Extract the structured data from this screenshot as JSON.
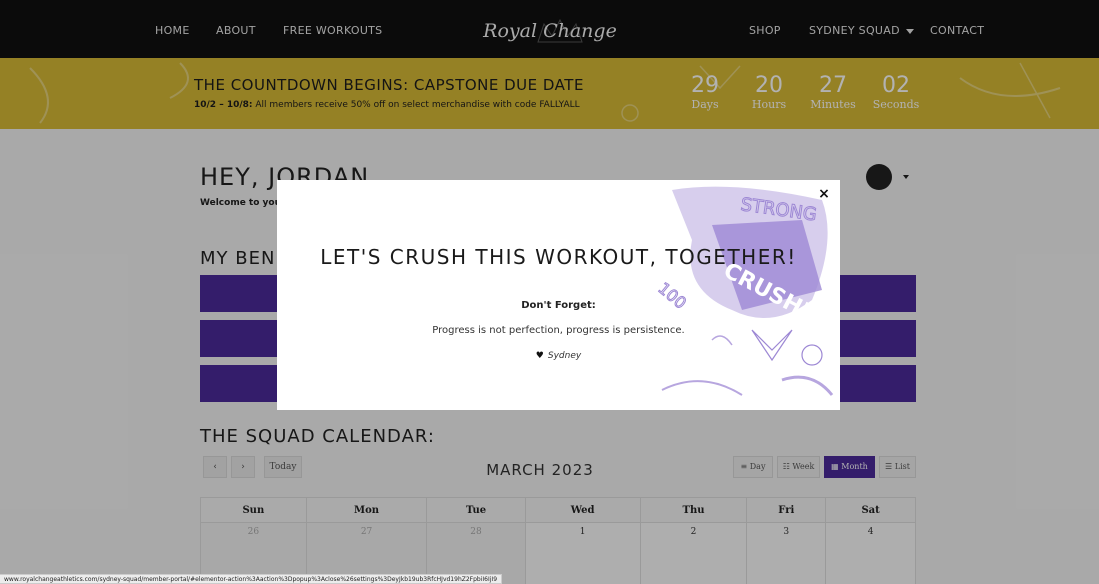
{
  "nav": {
    "items_left": [
      "HOME",
      "ABOUT",
      "FREE WORKOUTS"
    ],
    "logo_text": "Royal Change",
    "items_right": [
      "SHOP",
      "SYDNEY SQUAD",
      "CONTACT"
    ]
  },
  "banner": {
    "title": "THE COUNTDOWN BEGINS: CAPSTONE DUE DATE",
    "sub_bold": "10/2 – 10/8:",
    "sub_text": " All members receive 50% off on select merchandise with code FALLYALL",
    "countdown": [
      {
        "value": "29",
        "label": "Days"
      },
      {
        "value": "20",
        "label": "Hours"
      },
      {
        "value": "27",
        "label": "Minutes"
      },
      {
        "value": "02",
        "label": "Seconds"
      }
    ]
  },
  "main": {
    "greeting": "HEY, JORDAN",
    "welcome": "Welcome to you",
    "benefits_heading": "MY BENE",
    "calendar_heading": "THE SQUAD CALENDAR:"
  },
  "calendar": {
    "prev_label": "‹",
    "next_label": "›",
    "today_label": "Today",
    "month": "MARCH 2023",
    "views": [
      {
        "label": "Day",
        "icon": "≡"
      },
      {
        "label": "Week",
        "icon": "☷"
      },
      {
        "label": "Month",
        "icon": "▦"
      },
      {
        "label": "List",
        "icon": "☰"
      }
    ],
    "active_view": "Month",
    "weekdays": [
      "Sun",
      "Mon",
      "Tue",
      "Wed",
      "Thu",
      "Fri",
      "Sat"
    ],
    "first_row": [
      {
        "day": "26",
        "other": true
      },
      {
        "day": "27",
        "other": true
      },
      {
        "day": "28",
        "other": true
      },
      {
        "day": "1",
        "other": false
      },
      {
        "day": "2",
        "other": false
      },
      {
        "day": "3",
        "other": false
      },
      {
        "day": "4",
        "other": false
      }
    ]
  },
  "modal": {
    "title": "LET'S CRUSH THIS WORKOUT, TOGETHER!",
    "label": "Don't Forget:",
    "quote": "Progress is not perfection, progress is persistence.",
    "signature": "Sydney",
    "close": "×",
    "art_words": [
      "STRONG",
      "CRUSHED IT",
      "100"
    ]
  },
  "statusbar": "www.royalchangeathletics.com/sydney-squad/member-portal/#elementor-action%3Aaction%3Dpopup%3Aclose%26settings%3DeyJkb19ub3RfcHJvd19hZ2FpbiI6IjI9",
  "colors": {
    "nav_bg": "#111111",
    "banner_bg": "#d6b936",
    "accent_purple": "#4b2a9a",
    "art_purple": "#b7a6df"
  }
}
